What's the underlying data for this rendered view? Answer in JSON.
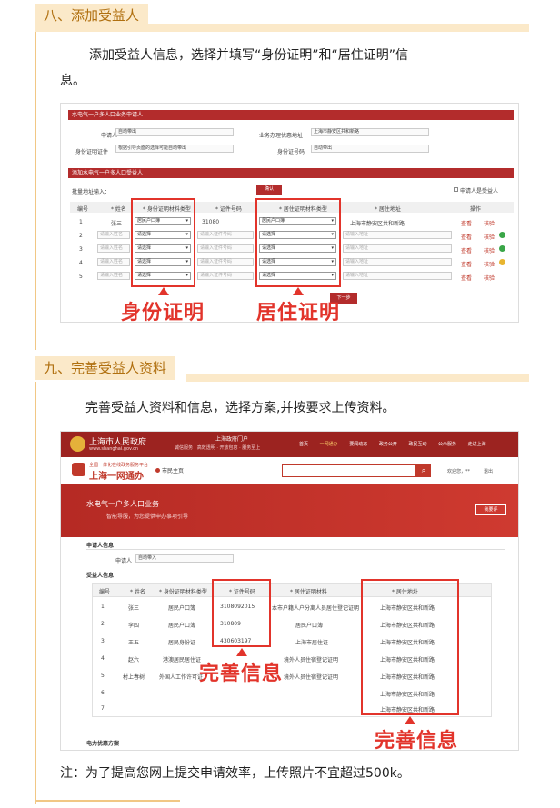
{
  "section8": {
    "title": "八、添加受益人",
    "para1": "添加受益人信息，选择并填写“身份证明”和“居住证明”信",
    "para2": "息。"
  },
  "shot1": {
    "header1": "水电气一户多人口业务申请人",
    "applicant_label": "申请人",
    "applicant_value": "自动带出",
    "addr_label": "业务办理优惠地址",
    "addr_value": "上海市静安区共和新路",
    "idtype_label": "身份证明证件",
    "idtype_value": "根据引导页面的选择可能自动带出",
    "idno_label": "身份证号码",
    "idno_value": "自动带出",
    "header2": "添加水电气一户多人口受益人",
    "batch_label": "批量地址输入：",
    "confirm_btn": "确认",
    "same_label": "申请人是受益人",
    "cols": [
      "编号",
      "* 姓名",
      "* 身份证明材料类型",
      "* 证件号码",
      "* 居住证明材料类型",
      "* 居住地址",
      "操作"
    ],
    "rows": [
      {
        "no": "1",
        "name": "张三",
        "idtype": "居民户口簿",
        "idno": "31080",
        "restype": "居民户口簿",
        "addr": "上海市静安区共和新路",
        "op1": "查看",
        "op2": "核验"
      },
      {
        "no": "2",
        "name": "请输入姓名",
        "idtype": "请选择",
        "idno": "请输入证件号码",
        "restype": "请选择",
        "addr": "请输入地址",
        "op1": "查看",
        "op2": "核验"
      },
      {
        "no": "3",
        "name": "请输入姓名",
        "idtype": "请选择",
        "idno": "请输入证件号码",
        "restype": "请选择",
        "addr": "请输入地址",
        "op1": "查看",
        "op2": "核验"
      },
      {
        "no": "4",
        "name": "请输入姓名",
        "idtype": "请选择",
        "idno": "请输入证件号码",
        "restype": "请选择",
        "addr": "请输入地址",
        "op1": "查看",
        "op2": "核验"
      },
      {
        "no": "5",
        "name": "请输入姓名",
        "idtype": "请选择",
        "idno": "请输入证件号码",
        "restype": "请选择",
        "addr": "请输入地址",
        "op1": "查看",
        "op2": "核验"
      }
    ],
    "callout1": "身份证明",
    "callout2": "居住证明",
    "next_btn": "下一步"
  },
  "section9": {
    "title": "九、完善受益人资料",
    "para": "完善受益人资料和信息，选择方案,并按要求上传资料。"
  },
  "shot2": {
    "gov_name": "上海市人民政府",
    "gov_url": "www.shanghai.gov.cn",
    "portal_label": "上海政府门户",
    "portal_sub": "诚信服务 · 高效透明 · 开放包容 · 服务至上",
    "nav": [
      "首页",
      "一网通办",
      "要闻动态",
      "政务公开",
      "政民互动",
      "公众服务",
      "走进上海"
    ],
    "yiwang_slogan": "全国一体化在线政务服务平台",
    "yiwang_name": "上海一网通办",
    "city_tab": "市民主页",
    "welcome": "欢迎您，**",
    "logout": "退出",
    "banner_title": "水电气一户多人口业务",
    "banner_sub": "智能导服，为您提供申办事项引导",
    "banner_btn": "我要评",
    "applicant_section": "申请人信息",
    "applicant_label": "申请人",
    "applicant_value": "自动带入",
    "beneficiary_section": "受益人信息",
    "cols": [
      "编号",
      "* 姓名",
      "* 身份证明材料类型",
      "* 证件号码",
      "* 居住证明材料",
      "* 居住地址"
    ],
    "rows": [
      {
        "no": "1",
        "name": "张三",
        "idtype": "居民户口簿",
        "idno": "3108092015",
        "restype": "本市户籍人户分离人员居住登记证明",
        "addr": "上海市静安区共和新路"
      },
      {
        "no": "2",
        "name": "李四",
        "idtype": "居民户口簿",
        "idno": "310809",
        "restype": "居民户口簿",
        "addr": "上海市静安区共和新路"
      },
      {
        "no": "3",
        "name": "王五",
        "idtype": "居民身份证",
        "idno": "430603197",
        "restype": "上海市居住证",
        "addr": "上海市静安区共和新路"
      },
      {
        "no": "4",
        "name": "赵六",
        "idtype": "港澳居民居住证",
        "idno": "",
        "restype": "境外人员住宿登记证明",
        "addr": "上海市静安区共和新路"
      },
      {
        "no": "5",
        "name": "村上春树",
        "idtype": "外国人工作许可证",
        "idno": "",
        "restype": "境外人员住宿登记证明",
        "addr": "上海市静安区共和新路"
      },
      {
        "no": "6",
        "name": "",
        "idtype": "",
        "idno": "",
        "restype": "",
        "addr": "上海市静安区共和新路"
      },
      {
        "no": "7",
        "name": "",
        "idtype": "",
        "idno": "",
        "restype": "",
        "addr": "上海市静安区共和新路"
      }
    ],
    "callout1": "完善信息",
    "callout2": "完善信息",
    "plan_section": "电力优惠方案"
  },
  "note": "注：为了提高您网上提交申请效率，上传照片不宜超过500k。"
}
